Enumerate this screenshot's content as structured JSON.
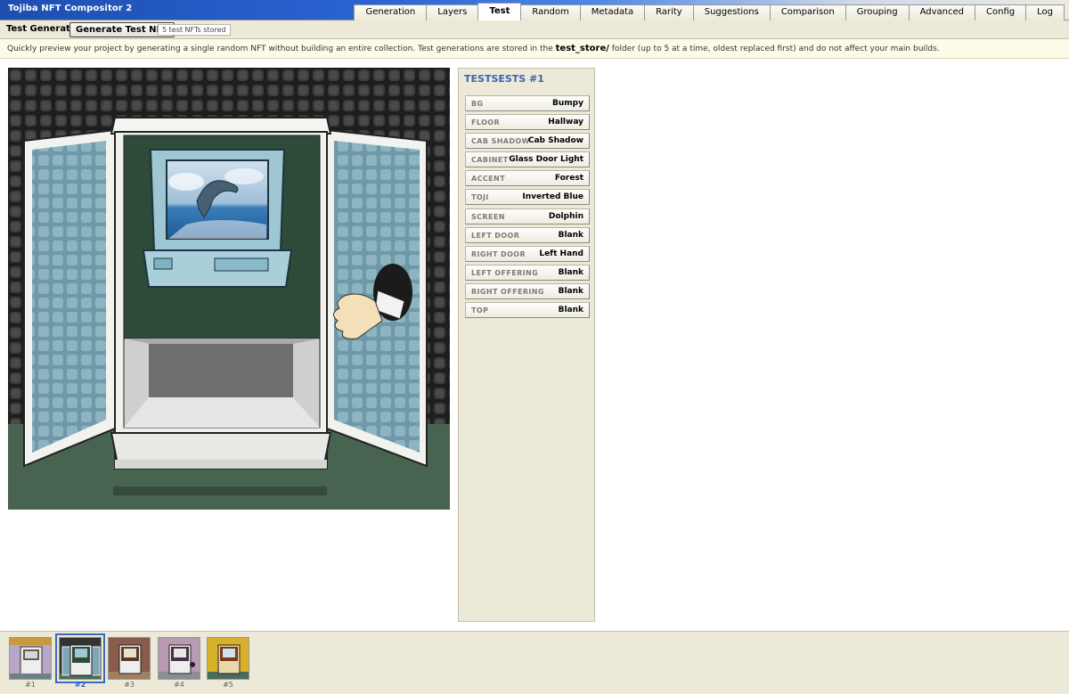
{
  "app": {
    "title": "Tojiba NFT Compositor 2"
  },
  "tabs": [
    {
      "label": "Generation",
      "active": false
    },
    {
      "label": "Layers",
      "active": false
    },
    {
      "label": "Test",
      "active": true
    },
    {
      "label": "Random",
      "active": false
    },
    {
      "label": "Metadata",
      "active": false
    },
    {
      "label": "Rarity",
      "active": false
    },
    {
      "label": "Suggestions",
      "active": false
    },
    {
      "label": "Comparison",
      "active": false
    },
    {
      "label": "Grouping",
      "active": false
    },
    {
      "label": "Advanced",
      "active": false
    },
    {
      "label": "Config",
      "active": false
    },
    {
      "label": "Log",
      "active": false
    }
  ],
  "toolbar": {
    "label": "Test Generator",
    "generate_label": "Generate Test NFT",
    "stored_text": "5 test NFTs stored"
  },
  "info": {
    "before": "Quickly preview your project by generating a single random NFT without building an entire collection. Test generations are stored in the ",
    "folder": "test_store/",
    "after": " folder (up to 5 at a time, oldest replaced first) and do not affect your main builds."
  },
  "traits_panel": {
    "title": "TESTSESTS #1",
    "traits": [
      {
        "key": "BG",
        "value": "Bumpy"
      },
      {
        "key": "FLOOR",
        "value": "Hallway"
      },
      {
        "key": "CAB SHADOW",
        "value": "Cab Shadow"
      },
      {
        "key": "CABINET",
        "value": "Glass Door Light"
      },
      {
        "key": "ACCENT",
        "value": "Forest"
      },
      {
        "key": "TOJI",
        "value": "Inverted Blue"
      },
      {
        "key": "SCREEN",
        "value": "Dolphin"
      },
      {
        "key": "LEFT DOOR",
        "value": "Blank"
      },
      {
        "key": "RIGHT DOOR",
        "value": "Left Hand"
      },
      {
        "key": "LEFT OFFERING",
        "value": "Blank"
      },
      {
        "key": "RIGHT OFFERING",
        "value": "Blank"
      },
      {
        "key": "TOP",
        "value": "Blank"
      }
    ]
  },
  "thumbnails": [
    {
      "label": "#1",
      "selected": false,
      "bg": "#b9a7c9",
      "accent": "#6a5a3a"
    },
    {
      "label": "#2",
      "selected": true,
      "bg": "#333333",
      "accent": "#2e4a38"
    },
    {
      "label": "#3",
      "selected": false,
      "bg": "#8a5a4a",
      "accent": "#5a3a28"
    },
    {
      "label": "#4",
      "selected": false,
      "bg": "#b99ab3",
      "accent": "#4a2f44"
    },
    {
      "label": "#5",
      "selected": false,
      "bg": "#d9b02a",
      "accent": "#7a3a1a"
    }
  ],
  "colors": {
    "accent_blue": "#3b64b0",
    "panel_bg": "#ece9d8",
    "cabinet_green": "#2e4a38",
    "glass": "#7ea7b5",
    "floor": "#4e6b58"
  },
  "icons": [
    "dolphin-image",
    "left-hand-image"
  ]
}
